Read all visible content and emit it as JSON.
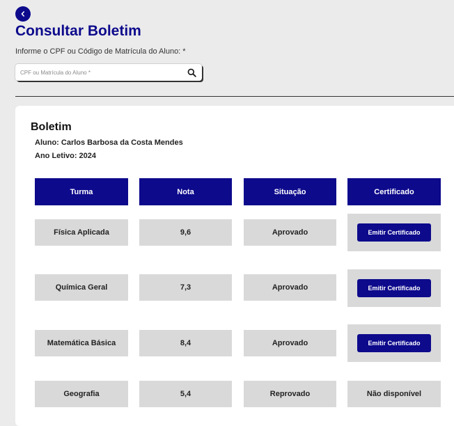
{
  "header": {
    "title": "Consultar Boletim",
    "field_label": "Informe o CPF ou Código de Matrícula do Aluno: *"
  },
  "search": {
    "placeholder": "CPF ou Matrícula do Aluno *",
    "value": ""
  },
  "boletim": {
    "title": "Boletim",
    "aluno": "Aluno: Carlos Barbosa da Costa Mendes",
    "ano_letivo": "Ano Letivo: 2024",
    "columns": [
      "Turma",
      "Nota",
      "Situação",
      "Certificado"
    ],
    "rows": [
      {
        "turma": "Física Aplicada",
        "nota": "9,6",
        "situacao": "Aprovado",
        "certificado": "Emitir Certificado"
      },
      {
        "turma": "Química Geral",
        "nota": "7,3",
        "situacao": "Aprovado",
        "certificado": "Emitir Certificado"
      },
      {
        "turma": "Matemática Básica",
        "nota": "8,4",
        "situacao": "Aprovado",
        "certificado": "Emitir Certificado"
      },
      {
        "turma": "Geografia",
        "nota": "5,4",
        "situacao": "Reprovado",
        "certificado": "Não disponível"
      }
    ]
  },
  "colors": {
    "primary": "#0d0a8c",
    "cell_bg": "#d9d9d9",
    "page_bg": "#ebebeb"
  },
  "icons": {
    "back": "chevron-left-icon",
    "search": "search-icon"
  }
}
